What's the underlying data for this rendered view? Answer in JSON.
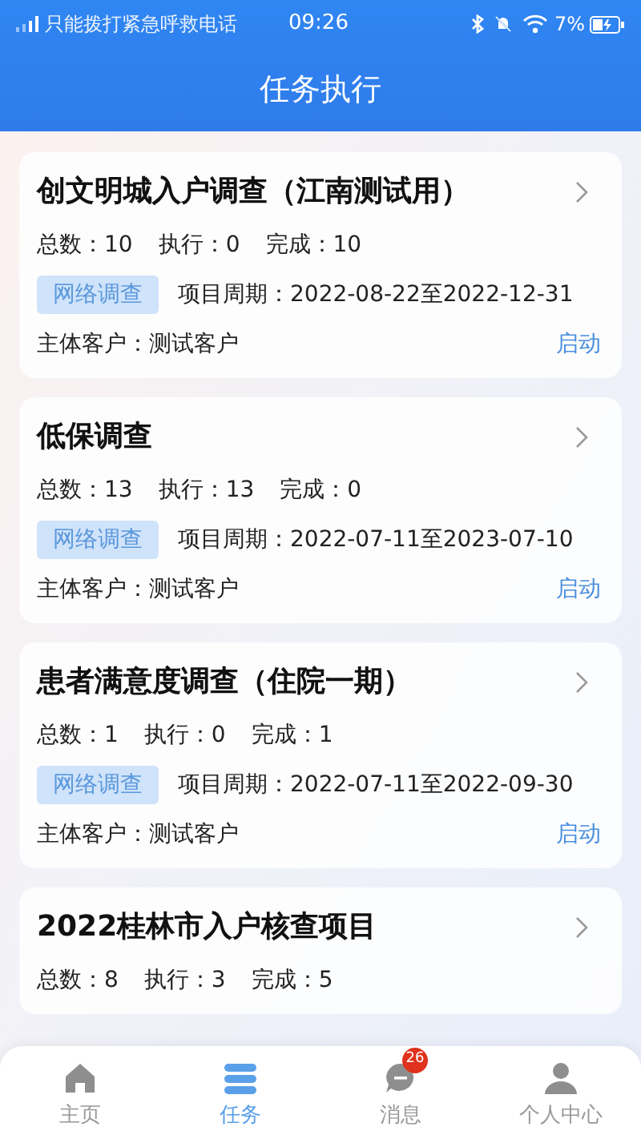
{
  "status_bar": {
    "carrier": "只能拨打紧急呼救电话",
    "time": "09:26",
    "battery": "7%"
  },
  "header": {
    "title": "任务执行"
  },
  "tasks": [
    {
      "title": "创文明城入户调查（江南测试用）",
      "total": "总数：10",
      "executing": "执行：0",
      "done": "完成：10",
      "tag": "网络调查",
      "period": "项目周期：2022-08-22至2022-12-31",
      "client": "主体客户：测试客户",
      "action": "启动"
    },
    {
      "title": "低保调查",
      "total": "总数：13",
      "executing": "执行：13",
      "done": "完成：0",
      "tag": "网络调查",
      "period": "项目周期：2022-07-11至2023-07-10",
      "client": "主体客户：测试客户",
      "action": "启动"
    },
    {
      "title": "患者满意度调查（住院一期）",
      "total": "总数：1",
      "executing": "执行：0",
      "done": "完成：1",
      "tag": "网络调查",
      "period": "项目周期：2022-07-11至2022-09-30",
      "client": "主体客户：测试客户",
      "action": "启动"
    },
    {
      "title": "2022桂林市入户核查项目",
      "total": "总数：8",
      "executing": "执行：3",
      "done": "完成：5"
    }
  ],
  "tab_bar": [
    {
      "kind": "home",
      "label": "主页",
      "selected": false
    },
    {
      "kind": "tasks",
      "label": "任务",
      "selected": true
    },
    {
      "kind": "messages",
      "label": "消息",
      "selected": false,
      "badge": "26"
    },
    {
      "kind": "profile",
      "label": "个人中心",
      "selected": false
    }
  ]
}
